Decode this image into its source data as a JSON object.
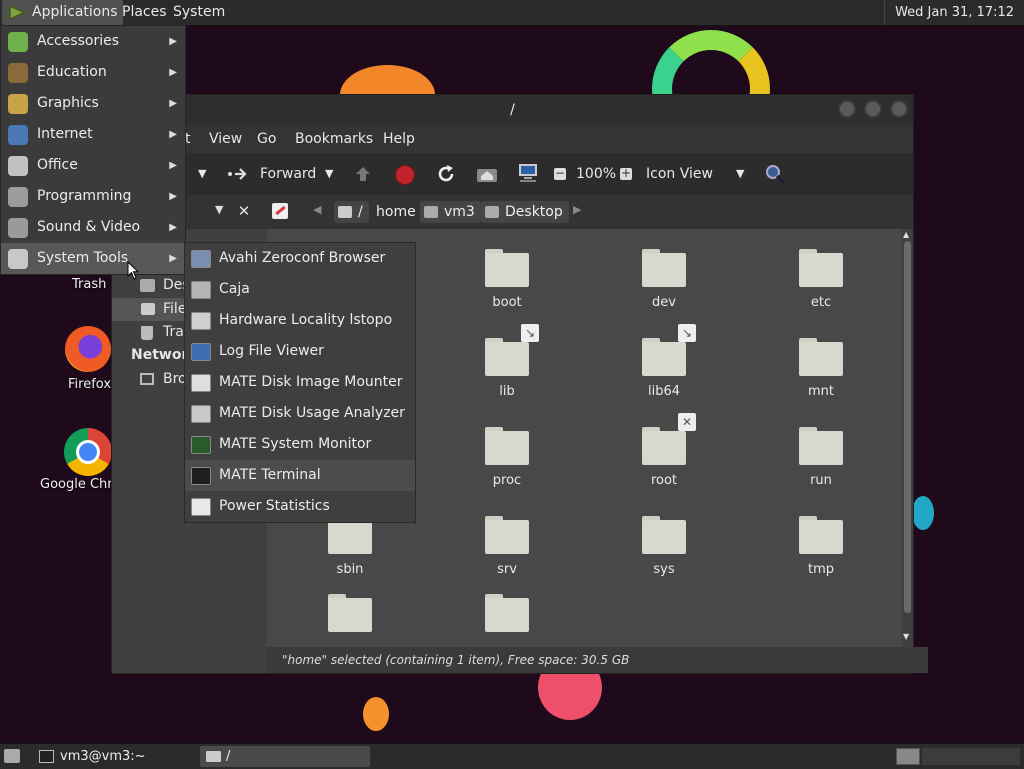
{
  "top_panel": {
    "applications": "Applications",
    "places": "Places",
    "system": "System",
    "clock": "Wed Jan 31, 17:12"
  },
  "app_menu": {
    "items": [
      {
        "label": "Accessories",
        "icon": "accessories-icon"
      },
      {
        "label": "Education",
        "icon": "education-icon"
      },
      {
        "label": "Graphics",
        "icon": "graphics-icon"
      },
      {
        "label": "Internet",
        "icon": "internet-icon"
      },
      {
        "label": "Office",
        "icon": "office-icon"
      },
      {
        "label": "Programming",
        "icon": "programming-icon"
      },
      {
        "label": "Sound & Video",
        "icon": "sound-video-icon"
      },
      {
        "label": "System Tools",
        "icon": "system-tools-icon"
      }
    ]
  },
  "system_tools_menu": {
    "items": [
      {
        "label": "Avahi Zeroconf Browser"
      },
      {
        "label": "Caja"
      },
      {
        "label": "Hardware Locality lstopo"
      },
      {
        "label": "Log File Viewer"
      },
      {
        "label": "MATE Disk Image Mounter"
      },
      {
        "label": "MATE Disk Usage Analyzer"
      },
      {
        "label": "MATE System Monitor"
      },
      {
        "label": "MATE Terminal"
      },
      {
        "label": "Power Statistics"
      }
    ]
  },
  "desktop": {
    "trash": "Trash",
    "firefox": "Firefox",
    "chrome": "Google Chr"
  },
  "window": {
    "title": "/",
    "menu": {
      "partial": "t",
      "view": "View",
      "go": "Go",
      "bookmarks": "Bookmarks",
      "help": "Help"
    },
    "toolbar": {
      "forward": "Forward",
      "zoom": "100%",
      "view_mode": "Icon View"
    },
    "location": {
      "root": "/",
      "home": "home",
      "user": "vm3",
      "desktop": "Desktop"
    },
    "sidebar": {
      "desktop": "Des",
      "filesystem": "File",
      "trash": "Tra",
      "network_header": "Network",
      "browse": "Bro"
    },
    "folders": [
      "boot",
      "dev",
      "etc",
      "lib",
      "lib64",
      "mnt",
      "proc",
      "root",
      "run",
      "sbin",
      "srv",
      "sys",
      "tmp"
    ],
    "status": "\"home\" selected (containing 1 item), Free space: 30.5 GB"
  },
  "taskbar": {
    "terminal": "vm3@vm3:~",
    "files": "/"
  },
  "colors": {
    "wallpaper": "#1f0a1c",
    "panel": "#2b2b2b",
    "menu": "#3b3b3b",
    "highlight": "#555555"
  }
}
